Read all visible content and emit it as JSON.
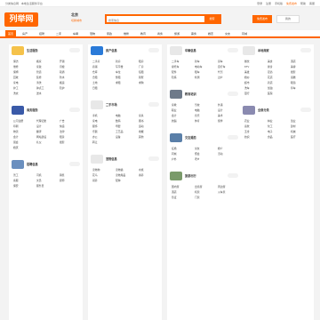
{
  "topbar": {
    "left": "分类信息网 · 本地生活服务平台",
    "links": [
      "登录",
      "注册",
      "手机版",
      "帮助",
      "客服"
    ],
    "highlight": "免费发布"
  },
  "logo": "列举网",
  "city": {
    "name": "北京",
    "switch": "切换城市"
  },
  "search": {
    "placeholder": "搜索信息",
    "button": "搜索"
  },
  "actions": {
    "publish": "免费发布",
    "mine": "我的"
  },
  "nav": [
    "首页",
    "房产",
    "招聘",
    "二手",
    "车辆",
    "宠物",
    "家政",
    "维修",
    "教育",
    "商务",
    "旅游",
    "票务",
    "婚恋",
    "交友",
    "同城"
  ],
  "nav_active": 0,
  "colors": {
    "accent": "#ff6600"
  },
  "columns": [
    {
      "cards": [
        {
          "title": "生活服务",
          "thumb": "#f5c24a",
          "links": [
            "保洁",
            "搬家",
            "开锁",
            "维修",
            "家政",
            "月嫂",
            "保姆",
            "管道",
            "疏通",
            "回收",
            "装修",
            "防水",
            "家电",
            "清洗",
            "搬运",
            "护工",
            "钟点工",
            "陪护",
            "洗衣",
            "送水"
          ]
        },
        {
          "title": "商务服务",
          "thumb": "#3a5aa8",
          "links": [
            "公司注册",
            "代理记账",
            "广告",
            "印刷",
            "设计",
            "快递",
            "物流",
            "翻译",
            "法律",
            "会计",
            "网站建设",
            "租赁",
            "展会",
            "礼仪",
            "摄影",
            "婚庆"
          ]
        },
        {
          "title": "招聘信息",
          "thumb": "#6a8fbf",
          "links": [
            "普工",
            "司机",
            "销售",
            "客服",
            "文员",
            "厨师",
            "保安",
            "服务员"
          ]
        }
      ]
    },
    {
      "cards": [
        {
          "title": "房产信息",
          "thumb": "#2a7ad8",
          "links": [
            "二手房",
            "新房",
            "租房",
            "商铺",
            "写字楼",
            "厂房",
            "仓库",
            "车位",
            "短租",
            "合租",
            "整租",
            "别墅",
            "土地",
            "求租",
            "求购",
            "日租"
          ]
        },
        {
          "title": "二手市场",
          "thumb": "#e8e8e8",
          "links": [
            "手机",
            "电脑",
            "家具",
            "家电",
            "数码",
            "图书",
            "服饰",
            "母婴",
            "运动",
            "乐器",
            "工艺品",
            "收藏",
            "办公",
            "设备",
            "其他",
            "转让"
          ]
        },
        {
          "title": "宠物信息",
          "thumb": "#e8e8e8",
          "links": [
            "宠物狗",
            "宠物猫",
            "水族",
            "花鸟",
            "宠物用品",
            "寄养",
            "领养",
            "配种"
          ]
        }
      ]
    },
    {
      "cards": [
        {
          "title": "车辆信息",
          "thumb": "#e8e8e8",
          "links": [
            "二手车",
            "新车",
            "货车",
            "摩托车",
            "电动车",
            "自行车",
            "配件",
            "租车",
            "代驾",
            "陪练",
            "检测",
            "过户"
          ]
        },
        {
          "title": "教育培训",
          "thumb": "#6e7a8a",
          "links": [
            "家教",
            "驾校",
            "外语",
            "职业",
            "电脑",
            "设计",
            "会计",
            "音乐",
            "美术",
            "舞蹈",
            "体育",
            "留学"
          ]
        },
        {
          "title": "交友婚恋",
          "thumb": "#5a7fa8",
          "links": [
            "征婚",
            "交友",
            "婚介",
            "同城",
            "聚会",
            "活动",
            "户外",
            "老乡"
          ]
        },
        {
          "title": "旅游出行",
          "thumb": "#7a9a6a",
          "links": [
            "国内游",
            "出境游",
            "周边游",
            "酒店",
            "机票",
            "火车票",
            "签证",
            "门票"
          ]
        }
      ]
    },
    {
      "cards": [
        {
          "title": "本地商家",
          "thumb": "#e8e8e8",
          "links": [
            "餐饮",
            "美食",
            "酒店",
            "KTV",
            "健身",
            "美容",
            "美发",
            "足浴",
            "摄影",
            "婚纱",
            "花店",
            "蛋糕",
            "超市",
            "药店",
            "眼镜",
            "洗车",
            "加油",
            "停车",
            "银行",
            "医院"
          ]
        },
        {
          "title": "全部分类",
          "thumb": "#8a8ab0",
          "links": [
            "农业",
            "林业",
            "渔业",
            "畜牧",
            "化工",
            "建材",
            "五金",
            "电子",
            "机械",
            "纺织",
            "食品",
            "医疗"
          ]
        }
      ]
    }
  ]
}
